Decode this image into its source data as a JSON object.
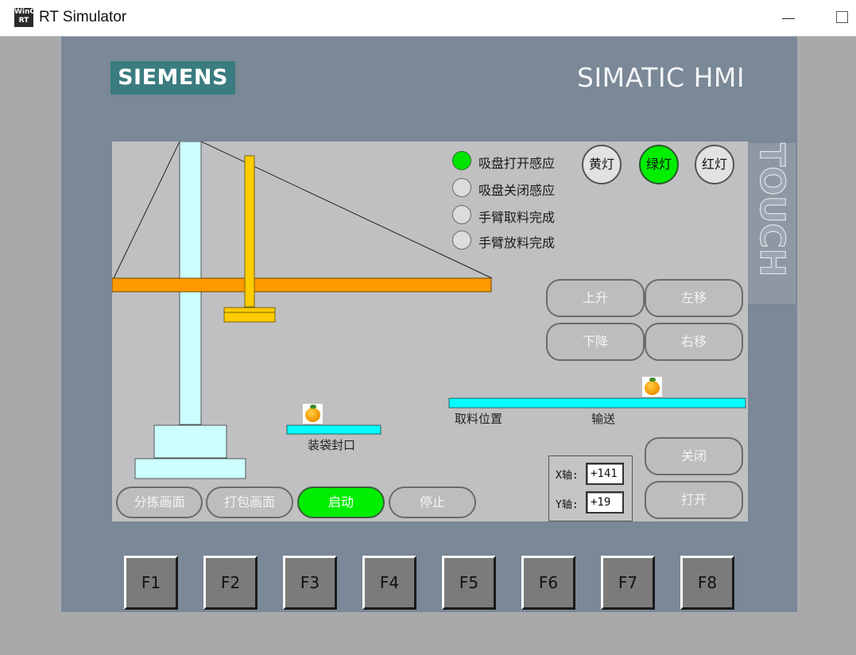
{
  "window": {
    "icon_text": "WinCC RT",
    "title": "RT Simulator"
  },
  "panel": {
    "brand": "SIEMENS",
    "model": "SIMATIC HMI",
    "touch_label": "TOUCH"
  },
  "indicators": [
    {
      "label": "吸盘打开感应",
      "on": true
    },
    {
      "label": "吸盘关闭感应",
      "on": false
    },
    {
      "label": "手臂取料完成",
      "on": false
    },
    {
      "label": "手臂放料完成",
      "on": false
    }
  ],
  "lamps": {
    "yellow": {
      "label": "黄灯",
      "on": false
    },
    "green": {
      "label": "绿灯",
      "on": true
    },
    "red": {
      "label": "红灯",
      "on": false
    }
  },
  "motion_buttons": {
    "up": "上升",
    "left": "左移",
    "down": "下降",
    "right": "右移"
  },
  "stations": {
    "pickup_label": "取料位置",
    "conveyor_label": "输送",
    "packing_label": "装袋封口"
  },
  "valve_buttons": {
    "close": "关闭",
    "open": "打开"
  },
  "axes": {
    "x_label": "X轴:",
    "x_value": "+141",
    "y_label": "Y轴:",
    "y_value": "+19"
  },
  "nav_buttons": {
    "sorting_screen": "分拣画面",
    "packing_screen": "打包画面",
    "start": "启动",
    "stop": "停止"
  },
  "function_keys": [
    "F1",
    "F2",
    "F3",
    "F4",
    "F5",
    "F6",
    "F7",
    "F8"
  ],
  "colors": {
    "bezel": "#7a8897",
    "screen_bg": "#c0c0c2",
    "crane_boom": "#ff9900",
    "crane_arm": "#ffcc00",
    "tower": "#ccffff",
    "conveyor": "#00ffff",
    "indicator_on": "#00e600"
  }
}
